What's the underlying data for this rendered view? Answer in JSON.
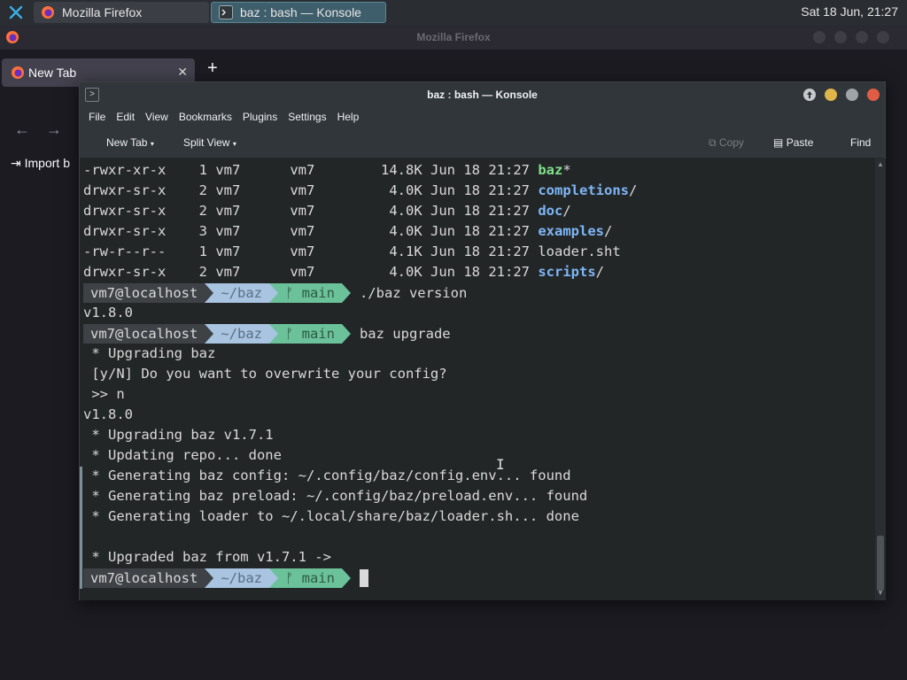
{
  "panel": {
    "tasks": [
      {
        "label": "Mozilla Firefox"
      },
      {
        "label": "baz : bash — Konsole"
      }
    ],
    "clock": "Sat 18 Jun, 21:27"
  },
  "firefox": {
    "title": "Mozilla Firefox",
    "tab_label": "New Tab",
    "new_tab": "+",
    "import_label": "Import b"
  },
  "konsole": {
    "title": "baz : bash — Konsole",
    "menu": [
      "File",
      "Edit",
      "View",
      "Bookmarks",
      "Plugins",
      "Settings",
      "Help"
    ],
    "toolbar": {
      "new_tab": "New Tab",
      "split_view": "Split View",
      "copy": "Copy",
      "paste": "Paste",
      "find": "Find"
    },
    "colors": {
      "close": "#e05d44",
      "minimize": "#e0b64a",
      "maximize": "#9ea4a8",
      "keep_above": "#c7c9cb"
    },
    "ls_rows": [
      {
        "perm": "-rwxr-xr-x",
        "links": "1",
        "user": "vm7",
        "group": "vm7",
        "size": "14.8K",
        "date": "Jun 18 21:27",
        "name": "baz",
        "suffix": "*",
        "kind": "exe"
      },
      {
        "perm": "drwxr-sr-x",
        "links": "2",
        "user": "vm7",
        "group": "vm7",
        "size": "4.0K",
        "date": "Jun 18 21:27",
        "name": "completions",
        "suffix": "/",
        "kind": "dir"
      },
      {
        "perm": "drwxr-sr-x",
        "links": "2",
        "user": "vm7",
        "group": "vm7",
        "size": "4.0K",
        "date": "Jun 18 21:27",
        "name": "doc",
        "suffix": "/",
        "kind": "dir"
      },
      {
        "perm": "drwxr-sr-x",
        "links": "3",
        "user": "vm7",
        "group": "vm7",
        "size": "4.0K",
        "date": "Jun 18 21:27",
        "name": "examples",
        "suffix": "/",
        "kind": "dir"
      },
      {
        "perm": "-rw-r--r--",
        "links": "1",
        "user": "vm7",
        "group": "vm7",
        "size": "4.1K",
        "date": "Jun 18 21:27",
        "name": "loader.sht",
        "suffix": "",
        "kind": "file"
      },
      {
        "perm": "drwxr-sr-x",
        "links": "2",
        "user": "vm7",
        "group": "vm7",
        "size": "4.0K",
        "date": "Jun 18 21:27",
        "name": "scripts",
        "suffix": "/",
        "kind": "dir"
      }
    ],
    "prompt": {
      "user": "vm7@localhost",
      "path": "~/baz",
      "branch": "ᚠ main"
    },
    "cmd1": "./baz version",
    "out1": "v1.8.0",
    "cmd2": "baz upgrade",
    "out2": [
      " * Upgrading baz",
      " [y/N] Do you want to overwrite your config?",
      " >> n",
      "v1.8.0",
      " * Upgrading baz v1.7.1",
      " * Updating repo... done",
      " * Generating baz config: ~/.config/baz/config.env... found",
      " * Generating baz preload: ~/.config/baz/preload.env... found",
      " * Generating loader to ~/.local/share/baz/loader.sh... done",
      "",
      " * Upgraded baz from v1.7.1 ->"
    ]
  }
}
